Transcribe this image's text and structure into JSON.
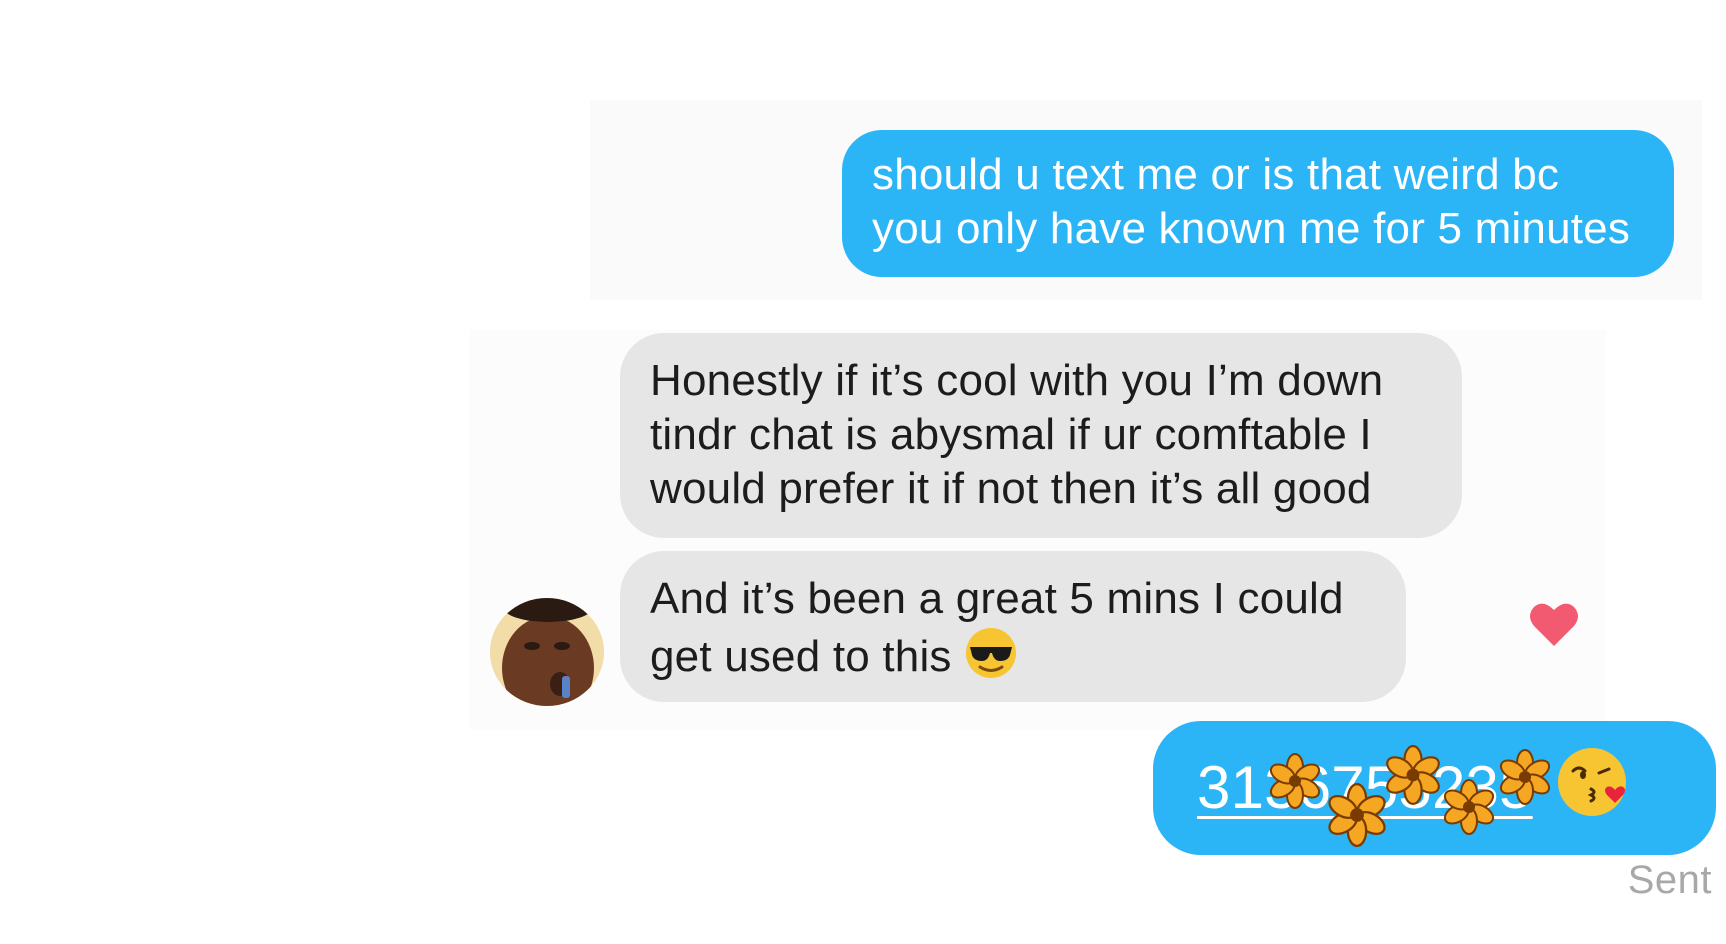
{
  "conversation": {
    "messages": [
      {
        "direction": "outgoing",
        "lines": [
          "should u text me or is that weird bc",
          "you only have known me for 5 minutes"
        ]
      },
      {
        "direction": "incoming",
        "lines": [
          "Honestly if it’s cool with you I’m down",
          "tindr chat is abysmal if ur comftable I",
          "would prefer it if not then it’s all good"
        ]
      },
      {
        "direction": "incoming",
        "lines": [
          "And it’s been a great 5 mins I could",
          "get used to this"
        ],
        "emoji": "smiling-face-with-sunglasses-emoji",
        "reaction": "heart-icon"
      },
      {
        "direction": "outgoing",
        "phone_number": "3136755235",
        "emoji": "face-blowing-a-kiss-emoji",
        "overlay": "flower-sticker-censor"
      }
    ],
    "status": "Sent"
  },
  "colors": {
    "outgoing_bubble": "#2bb5f6",
    "incoming_bubble": "#e6e6e6",
    "heart": "#f25a72",
    "status_text": "#a8a8a8"
  }
}
